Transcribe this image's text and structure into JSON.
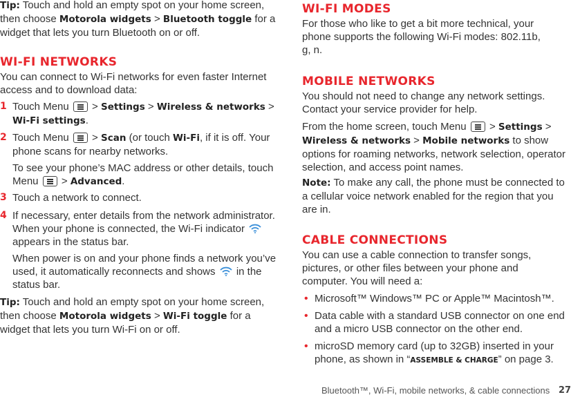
{
  "colors": {
    "accent": "#e8262d",
    "text": "#333333"
  },
  "left": {
    "tip1": [
      {
        "b": "Tip:"
      },
      {
        "t": " Touch and hold an empty spot on your home screen, then choose "
      },
      {
        "b": "Motorola widgets"
      },
      {
        "t": " > "
      },
      {
        "b": "Bluetooth toggle"
      },
      {
        "t": " for a widget that lets you turn Bluetooth on or off."
      }
    ],
    "wifi_heading": "Wi-Fi networks",
    "wifi_intro": [
      {
        "t": "You can connect to Wi-Fi networks for even faster Internet access and to download data:"
      }
    ],
    "steps": [
      {
        "num": "1",
        "segs": [
          {
            "t": "Touch Menu "
          },
          {
            "icon": "menu-icon"
          },
          {
            "t": " > "
          },
          {
            "b": "Settings"
          },
          {
            "t": " > "
          },
          {
            "b": "Wireless & networks"
          },
          {
            "t": " > "
          },
          {
            "b": "Wi-Fi settings"
          },
          {
            "t": "."
          }
        ]
      },
      {
        "num": "2",
        "segs": [
          {
            "t": "Touch Menu "
          },
          {
            "icon": "menu-icon"
          },
          {
            "t": " > "
          },
          {
            "b": "Scan"
          },
          {
            "t": " (or touch "
          },
          {
            "b": "Wi-Fi"
          },
          {
            "t": ", if it is off. Your phone scans for nearby networks."
          }
        ]
      },
      {
        "num": "",
        "segs": [
          {
            "t": "To see your phone’s MAC address or other details, touch Menu "
          },
          {
            "icon": "menu-icon"
          },
          {
            "t": " > "
          },
          {
            "b": "Advanced"
          },
          {
            "t": "."
          }
        ]
      },
      {
        "num": "3",
        "segs": [
          {
            "t": "Touch a network to connect."
          }
        ]
      },
      {
        "num": "4",
        "segs": [
          {
            "t": "If necessary, enter details from the network administrator. When your phone is connected, the Wi-Fi indicator "
          },
          {
            "icon": "wifi-icon"
          },
          {
            "t": " appears in the status bar."
          }
        ]
      },
      {
        "num": "",
        "segs": [
          {
            "t": "When power is on and your phone finds a network you’ve used, it automatically reconnects and shows "
          },
          {
            "icon": "wifi-icon"
          },
          {
            "t": " in the status bar."
          }
        ]
      }
    ],
    "tip2": [
      {
        "b": "Tip:"
      },
      {
        "t": " Touch and hold an empty spot on your home screen, then choose "
      },
      {
        "b": "Motorola widgets"
      },
      {
        "t": " > "
      },
      {
        "b": "Wi-Fi toggle"
      },
      {
        "t": " for a widget that lets you turn Wi-Fi on or off."
      }
    ]
  },
  "right": {
    "modes_heading": "Wi-Fi modes",
    "modes_p": [
      {
        "t": "For those who like to get a bit more technical, your phone supports the following Wi-Fi modes: 802.11b, g, n."
      }
    ],
    "mobile_heading": "Mobile networks",
    "mobile_p1": [
      {
        "t": "You should not need to change any network settings. Contact your service provider for help."
      }
    ],
    "mobile_p2": [
      {
        "t": "From the home screen, touch Menu "
      },
      {
        "icon": "menu-icon"
      },
      {
        "t": " > "
      },
      {
        "b": "Settings"
      },
      {
        "t": " > "
      },
      {
        "b": "Wireless & networks"
      },
      {
        "t": " > "
      },
      {
        "b": "Mobile networks"
      },
      {
        "t": " to show options for roaming networks, network selection, operator selection, and access point names."
      }
    ],
    "note": [
      {
        "b": "Note:"
      },
      {
        "t": " To make any call, the phone must be connected to a cellular voice network enabled for the region that you are in."
      }
    ],
    "cable_heading": "Cable connections",
    "cable_p": [
      {
        "t": "You can use a cable connection to transfer songs, pictures, or other files between your phone and computer. You will need a:"
      }
    ],
    "bullets": [
      [
        {
          "t": "Microsoft™ Windows™ PC or Apple™ Macintosh™."
        }
      ],
      [
        {
          "t": "Data cable with a standard USB connector on one end and a micro USB connector on the other end."
        }
      ],
      [
        {
          "t": "microSD memory card (up to 32GB) inserted in your phone, as shown in “"
        },
        {
          "sc": "Assemble & Charge"
        },
        {
          "t": "” on page 3."
        }
      ]
    ]
  },
  "footer": {
    "section": "Bluetooth™, Wi-Fi, mobile networks, & cable connections",
    "page": "27"
  }
}
